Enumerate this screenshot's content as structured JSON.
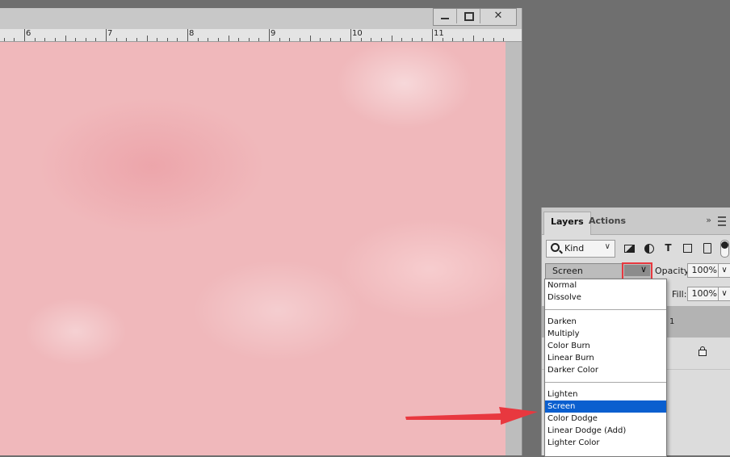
{
  "window": {
    "minimize_label": "–",
    "maximize_label": "□",
    "close_label": "✕"
  },
  "ruler": {
    "numbers": [
      "6",
      "7",
      "8",
      "9",
      "10",
      "11"
    ]
  },
  "layers_panel": {
    "tabs": [
      {
        "label": "Layers",
        "active": true
      },
      {
        "label": "Actions",
        "active": false
      }
    ],
    "collapse_label": "»",
    "kind_label": "Kind",
    "type_filter_label": "T",
    "blend_mode": "Screen",
    "opacity_label": "Opacity:",
    "opacity_value": "100%",
    "fill_label": "Fill:",
    "fill_value": "100%",
    "layer_name_partial": "l 1"
  },
  "blend_dropdown": {
    "groups": [
      [
        "Normal",
        "Dissolve"
      ],
      [
        "Darken",
        "Multiply",
        "Color Burn",
        "Linear Burn",
        "Darker Color"
      ],
      [
        "Lighten",
        "Screen",
        "Color Dodge",
        "Linear Dodge (Add)",
        "Lighter Color"
      ]
    ],
    "selected": "Screen"
  },
  "colors": {
    "accent_selected": "#0a5fcf",
    "annotation_red": "#e8383f",
    "canvas_pink": "#f0b8bb"
  }
}
